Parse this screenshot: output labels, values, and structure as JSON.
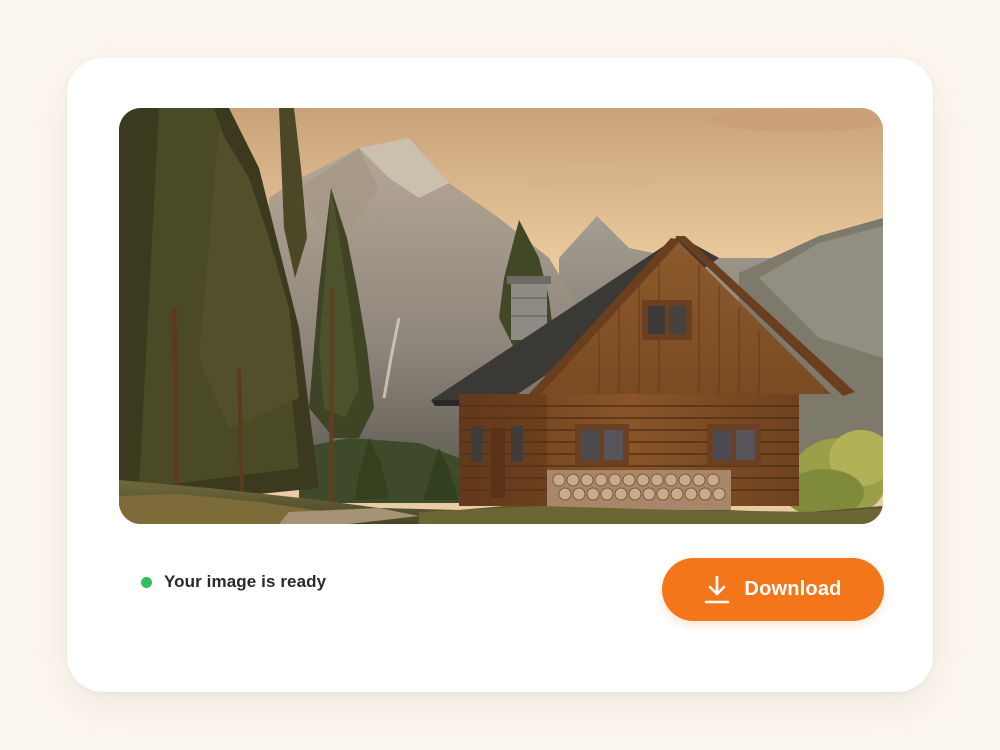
{
  "result": {
    "status_text": "Your image is ready",
    "status_color": "#2fbf5f",
    "image_subject": "log cabin in mountain forest at sunset",
    "download": {
      "label": "Download",
      "icon": "download-icon",
      "color": "#f4761b"
    }
  }
}
